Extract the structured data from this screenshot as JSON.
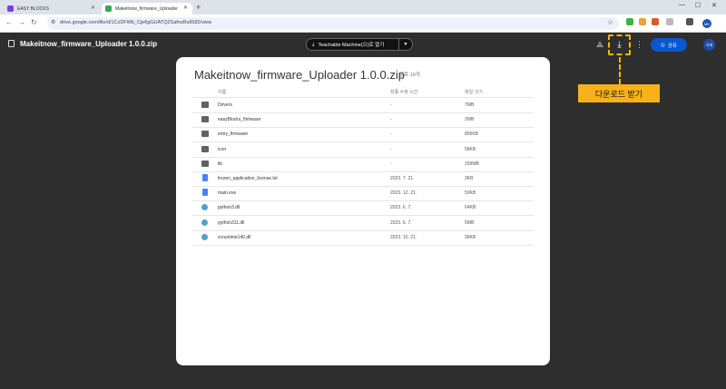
{
  "browser": {
    "tabs": [
      {
        "title": "EASY BLOCKS",
        "active": false,
        "favicon_color": "#7b3fe4"
      },
      {
        "title": "Makeitnow_firmware_Uploader",
        "active": true,
        "favicon_color": "#34a853"
      }
    ],
    "new_tab_label": "+",
    "url": "drive.google.com/file/d/1CzDFWb_Cje6gGUATQ2SafnsRsII582/view",
    "profile_initials": "MK"
  },
  "viewer": {
    "file_title": "Makeitnow_firmware_Uploader 1.0.0.zip",
    "open_with_label": "Teachable Machine(으)로 열기",
    "share_label": "공유",
    "account_initials": "가새",
    "download_callout": "다운로드 받기"
  },
  "card": {
    "title": "Makeitnow_firmware_Uploader 1.0.0.zip",
    "item_count": "항목 10개",
    "columns": {
      "name": "이름",
      "modified": "최종 수정 시간",
      "size": "파일 크기"
    },
    "rows": [
      {
        "type": "folder",
        "name": "Drivers",
        "modified": "-",
        "size": "7MB"
      },
      {
        "type": "folder",
        "name": "easyBlocks_firmware",
        "modified": "-",
        "size": "2MB"
      },
      {
        "type": "folder",
        "name": "entry_firmware",
        "modified": "-",
        "size": "805KB"
      },
      {
        "type": "folder",
        "name": "icon",
        "modified": "-",
        "size": "58KB"
      },
      {
        "type": "folder",
        "name": "lib",
        "modified": "-",
        "size": "159MB"
      },
      {
        "type": "doc",
        "name": "frozen_application_license.txt",
        "modified": "2023. 7. 21.",
        "size": "3KB"
      },
      {
        "type": "doc",
        "name": "main.exe",
        "modified": "2023. 12. 21.",
        "size": "50KB"
      },
      {
        "type": "py",
        "name": "python3.dll",
        "modified": "2023. 6. 7.",
        "size": "64KB"
      },
      {
        "type": "py",
        "name": "python311.dll",
        "modified": "2023. 6. 7.",
        "size": "5MB"
      },
      {
        "type": "py",
        "name": "vcruntime140.dll",
        "modified": "2023. 10. 21.",
        "size": "99KB"
      }
    ]
  },
  "colors": {
    "accent_yellow": "#f7b21b",
    "share_blue": "#0b57d0",
    "backdrop": "#2e2e2e"
  }
}
